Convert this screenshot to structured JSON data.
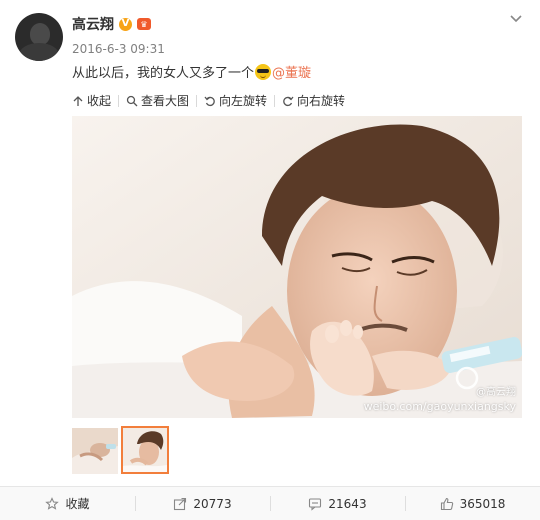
{
  "post": {
    "username": "高云翔",
    "timestamp": "2016-6-3 09:31",
    "text": "从此以后，我的女人又多了一个",
    "mention": "@董璇"
  },
  "image_toolbar": {
    "collapse": "收起",
    "view_large": "查看大图",
    "rotate_left": "向左旋转",
    "rotate_right": "向右旋转"
  },
  "watermark": {
    "user": "@高云翔",
    "url": "weibo.com/gaoyunxiangsky"
  },
  "actions": {
    "favorite": "收藏",
    "repost_count": "20773",
    "comment_count": "21643",
    "like_count": "365018"
  },
  "colors": {
    "mention": "#eb7350",
    "vip": "#f7a316",
    "thumb_selected_border": "#f27e3b"
  },
  "icons": [
    "avatar",
    "vip-icon",
    "member-icon",
    "chevron-down-icon",
    "cool-emoji-icon",
    "collapse-icon",
    "zoom-icon",
    "rotate-left-icon",
    "rotate-right-icon",
    "star-icon",
    "share-icon",
    "comment-icon",
    "thumbs-up-icon"
  ]
}
